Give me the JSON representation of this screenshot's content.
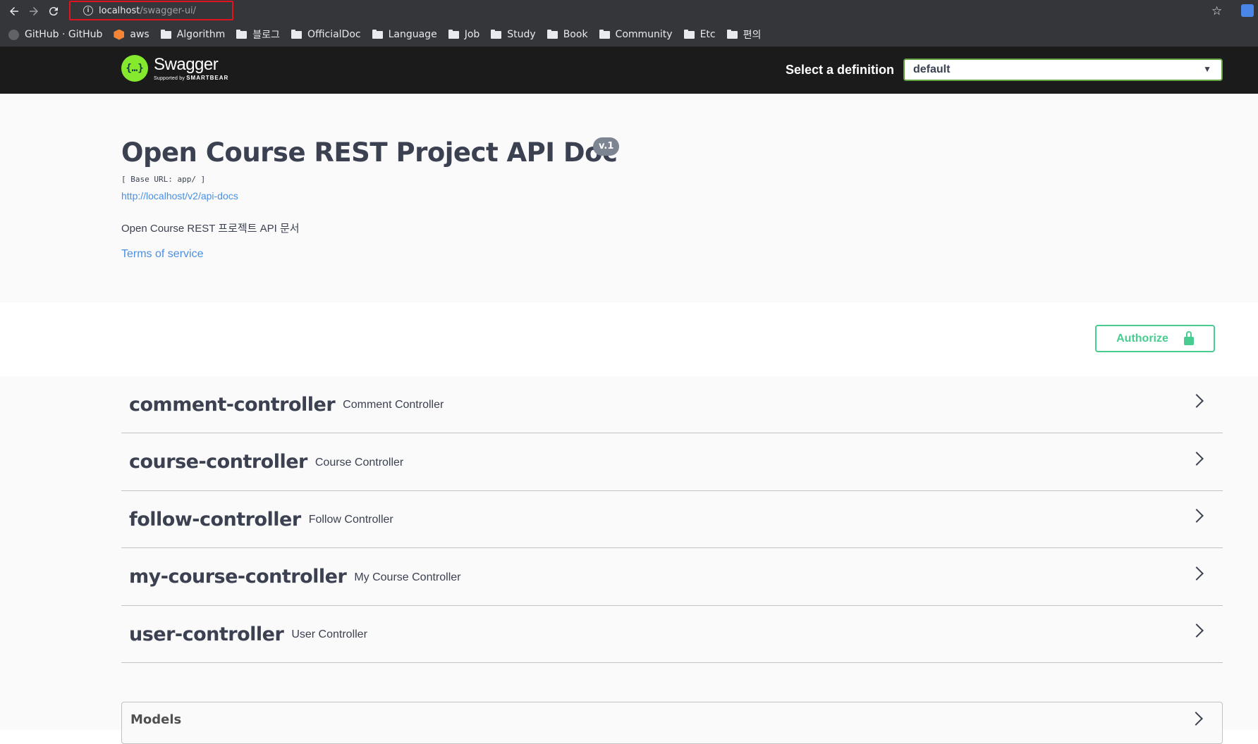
{
  "browser": {
    "url_host": "localhost",
    "url_path": "/swagger-ui/",
    "bookmarks": [
      {
        "label": "GitHub · GitHub",
        "icon": "github-icon"
      },
      {
        "label": "aws",
        "icon": "aws-icon"
      },
      {
        "label": "Algorithm",
        "icon": "folder-icon"
      },
      {
        "label": "블로그",
        "icon": "folder-icon"
      },
      {
        "label": "OfficialDoc",
        "icon": "folder-icon"
      },
      {
        "label": "Language",
        "icon": "folder-icon"
      },
      {
        "label": "Job",
        "icon": "folder-icon"
      },
      {
        "label": "Study",
        "icon": "folder-icon"
      },
      {
        "label": "Book",
        "icon": "folder-icon"
      },
      {
        "label": "Community",
        "icon": "folder-icon"
      },
      {
        "label": "Etc",
        "icon": "folder-icon"
      },
      {
        "label": "편의",
        "icon": "folder-icon"
      }
    ]
  },
  "topbar": {
    "logo_name": "Swagger",
    "logo_supported": "Supported by",
    "logo_company": "SMARTBEAR",
    "definition_label": "Select a definition",
    "definition_value": "default"
  },
  "info": {
    "title": "Open Course REST Project API Doc",
    "version": "v.1",
    "base_url": "[ Base URL: app/ ]",
    "api_docs_link": "http://localhost/v2/api-docs",
    "description": "Open Course REST 프로젝트 API 문서",
    "terms_of_service": "Terms of service"
  },
  "scheme": {
    "authorize_label": "Authorize"
  },
  "tags": [
    {
      "name": "comment-controller",
      "description": "Comment Controller"
    },
    {
      "name": "course-controller",
      "description": "Course Controller"
    },
    {
      "name": "follow-controller",
      "description": "Follow Controller"
    },
    {
      "name": "my-course-controller",
      "description": "My Course Controller"
    },
    {
      "name": "user-controller",
      "description": "User Controller"
    }
  ],
  "models": {
    "title": "Models"
  },
  "colors": {
    "topbar_bg": "#1b1b1b",
    "logo_green": "#85ea2d",
    "authorize_green": "#49cc90",
    "link_blue": "#4990e2",
    "text_dark": "#3b4151"
  }
}
